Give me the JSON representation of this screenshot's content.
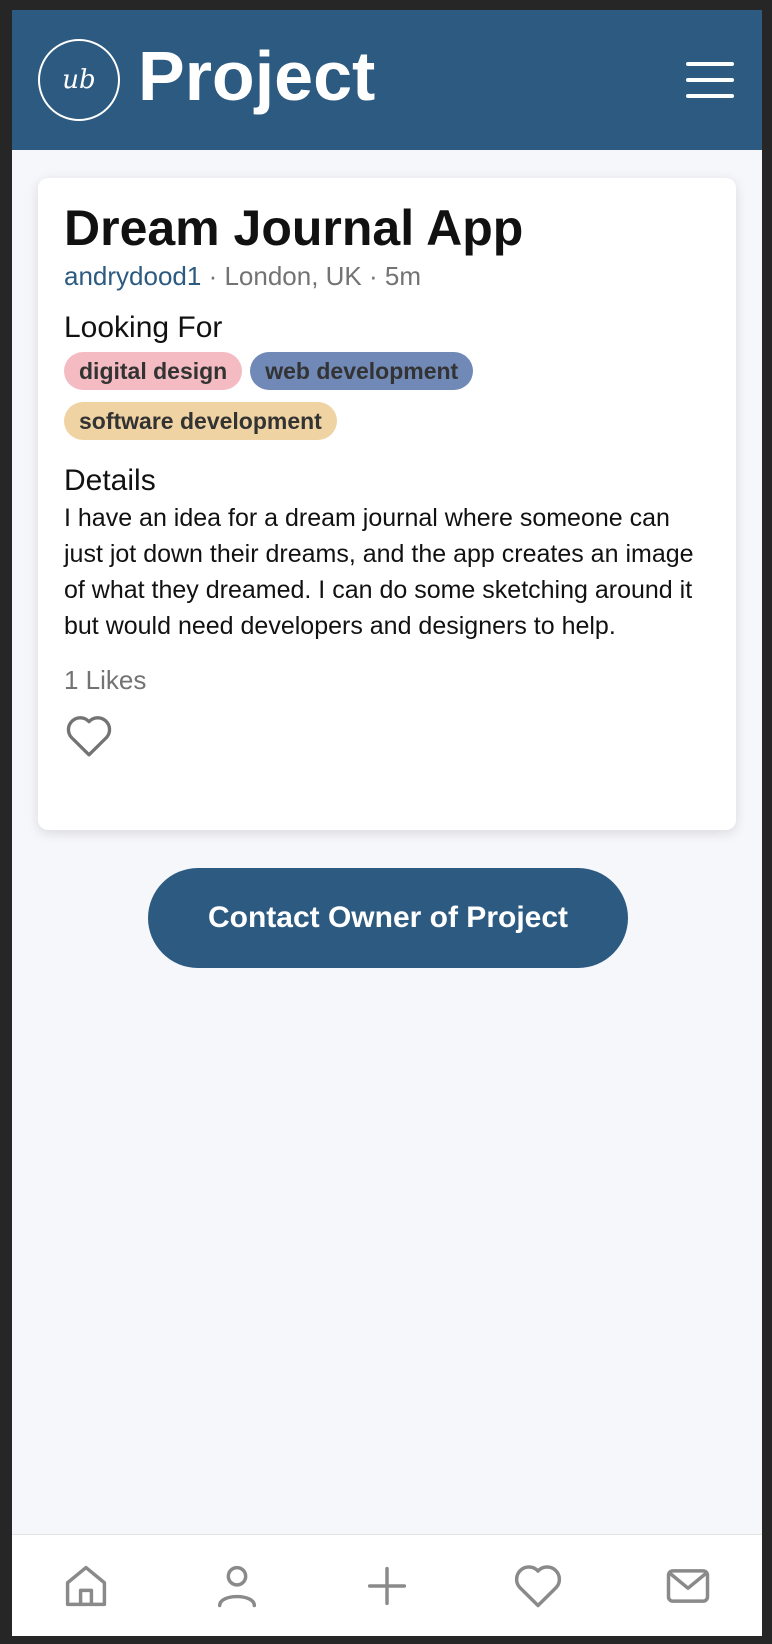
{
  "header": {
    "logo_text": "ub",
    "title": "Project",
    "menu_icon": "hamburger-menu-icon"
  },
  "project": {
    "title": "Dream Journal App",
    "username": "andrydood1",
    "meta_rest": " · London, UK · 5m",
    "looking_for_label": "Looking For",
    "tags": [
      {
        "label": "digital design",
        "color": "#f4bcc2"
      },
      {
        "label": "web development",
        "color": "#7089b7"
      },
      {
        "label": "software development",
        "color": "#f0d3a3"
      }
    ],
    "details_label": "Details",
    "details_text": "I have an idea for a dream journal where someone can just jot down their dreams, and the app creates an image of what they dreamed. I can do some sketching around it but would need developers and designers to help.",
    "likes_text": "1 Likes",
    "like_icon": "heart-outline-icon"
  },
  "contact_button_label": "Contact Owner of Project",
  "bottom_nav": {
    "items": [
      "home-icon",
      "profile-icon",
      "add-icon",
      "favorites-icon",
      "messages-icon"
    ]
  },
  "colors": {
    "primary": "#2d5a80",
    "background": "#f6f7fb",
    "muted_text": "#737373"
  }
}
